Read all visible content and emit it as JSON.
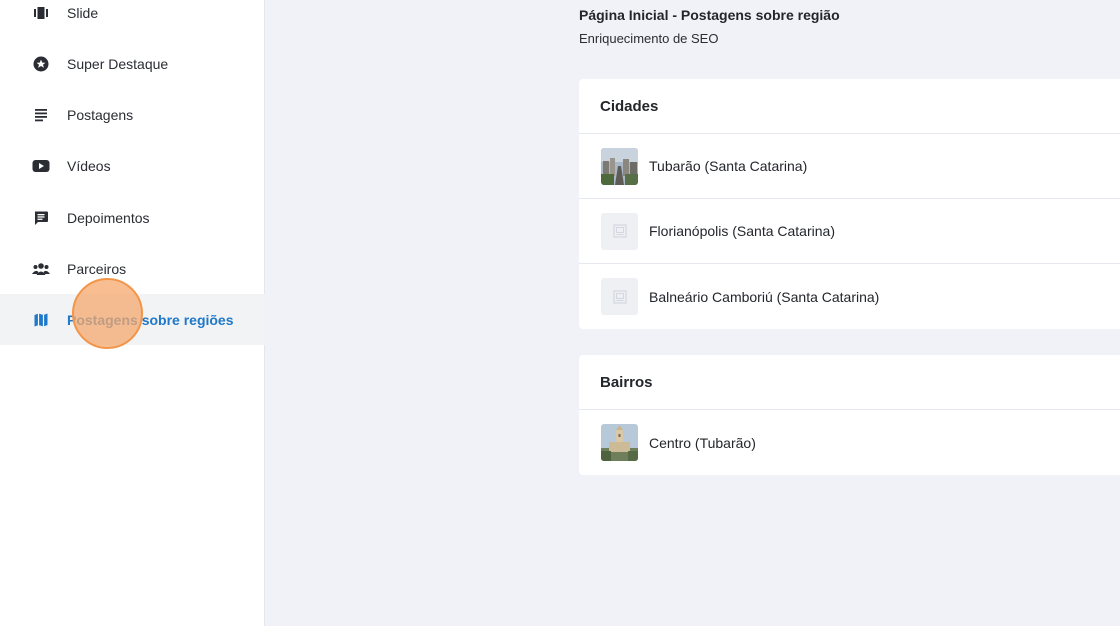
{
  "sidebar": {
    "items": [
      {
        "label": "Slide",
        "icon": "slide-icon",
        "active": false
      },
      {
        "label": "Super Destaque",
        "icon": "star-badge-icon",
        "active": false
      },
      {
        "label": "Postagens",
        "icon": "text-lines-icon",
        "active": false
      },
      {
        "label": "Vídeos",
        "icon": "video-icon",
        "active": false
      },
      {
        "label": "Depoimentos",
        "icon": "chat-icon",
        "active": false
      },
      {
        "label": "Parceiros",
        "icon": "people-icon",
        "active": false
      },
      {
        "label": "Postagens sobre regiões",
        "icon": "map-icon",
        "active": true
      }
    ]
  },
  "header": {
    "title": "Página Inicial - Postagens sobre região",
    "subtitle": "Enriquecimento de SEO"
  },
  "cities": {
    "title": "Cidades",
    "rows": [
      {
        "name": "Tubarão (Santa Catarina)",
        "thumb": "city-photo"
      },
      {
        "name": "Florianópolis (Santa Catarina)",
        "thumb": "image-placeholder"
      },
      {
        "name": "Balneário Camboriú (Santa Catarina)",
        "thumb": "image-placeholder"
      }
    ]
  },
  "neighborhoods": {
    "title": "Bairros",
    "rows": [
      {
        "name": "Centro (Tubarão)",
        "thumb": "church-photo"
      }
    ]
  },
  "colors": {
    "accent": "#1f78c8",
    "background": "#f0f2f7",
    "click_marker": "#f29548"
  }
}
